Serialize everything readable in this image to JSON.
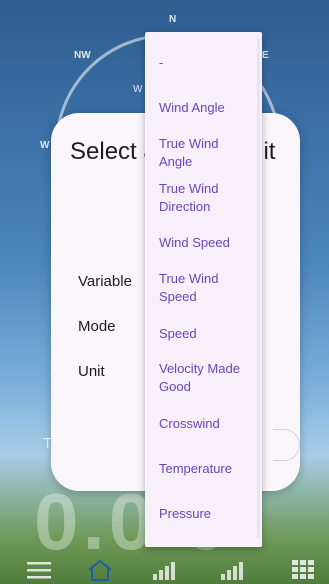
{
  "background": {
    "compass": {
      "n": "N",
      "nw": "NW",
      "ne": "E",
      "w": "W",
      "inner": "W"
    },
    "reading": "0.0 0"
  },
  "dialog": {
    "title": "Select and th d unit",
    "fields": {
      "variable_label": "Variable",
      "mode_label": "Mode",
      "unit_label": "Unit"
    },
    "fragment": "T"
  },
  "dropdown": {
    "items": [
      "-",
      "Wind Angle",
      "True Wind Angle",
      "True Wind Direction",
      "Wind Speed",
      "True Wind Speed",
      "Speed",
      "Velocity Made Good",
      "Crosswind",
      "Temperature",
      "Pressure"
    ]
  },
  "bottom_nav": {
    "icons": [
      "menu-icon",
      "home-icon",
      "signal-icon",
      "signal-icon",
      "grid-icon"
    ]
  },
  "colors": {
    "accent": "#6c44b8",
    "dialog_bg": "#fbf6fc",
    "menu_bg": "#f7f0fb"
  }
}
